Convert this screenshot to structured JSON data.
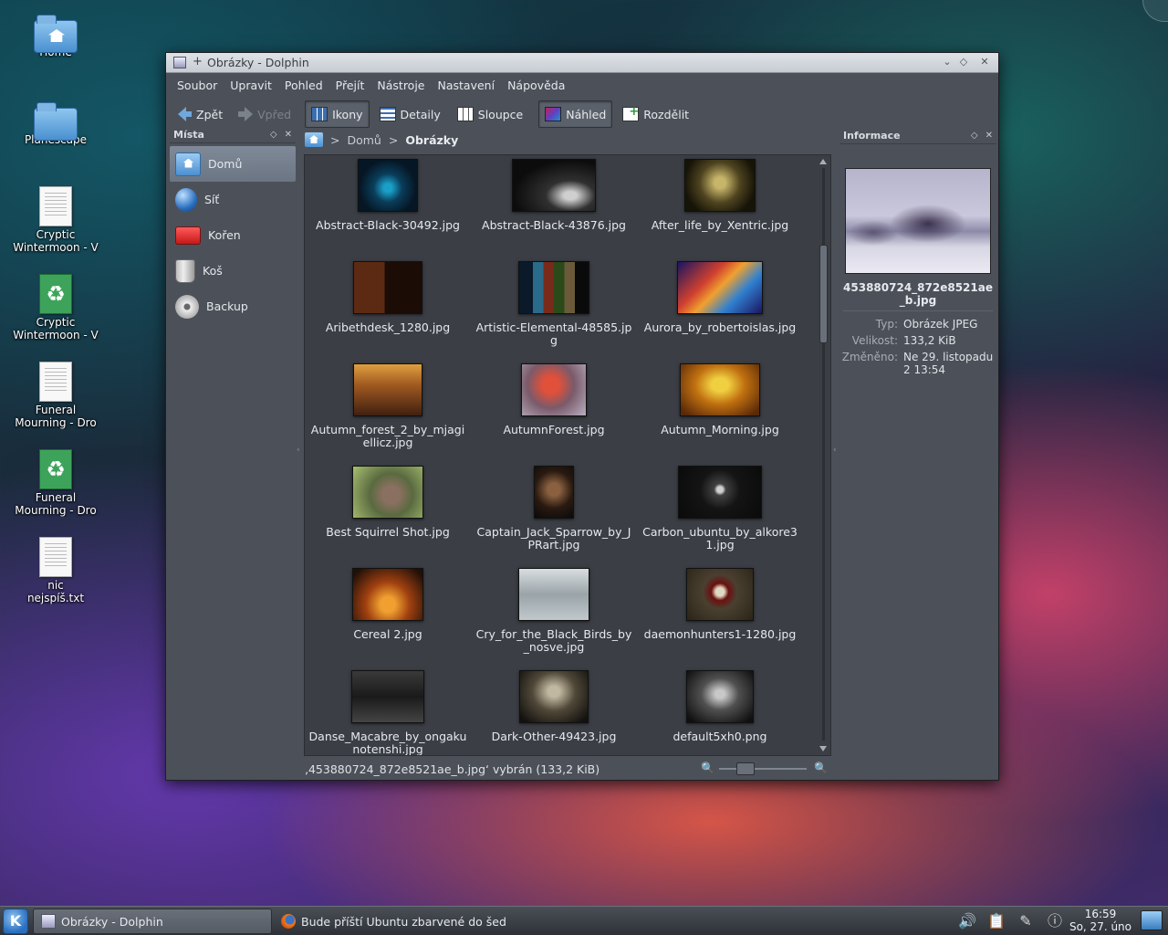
{
  "desktop": {
    "icons": [
      {
        "label": "Home",
        "kind": "home-folder"
      },
      {
        "label": "Planescape",
        "kind": "folder"
      },
      {
        "label": "Cryptic Wintermoon - V",
        "kind": "document"
      },
      {
        "label": "Cryptic Wintermoon - V",
        "kind": "recycle"
      },
      {
        "label": "Funeral Mourning - Dro",
        "kind": "document"
      },
      {
        "label": "Funeral Mourning - Dro",
        "kind": "recycle"
      },
      {
        "label": "nic nejspíš.txt",
        "kind": "document"
      }
    ]
  },
  "window": {
    "title": "Obrázky - Dolphin",
    "pin_glyph": "+",
    "buttons": {
      "minimize": "⌄",
      "maximize": "◇",
      "close": "✕"
    },
    "menu": [
      "Soubor",
      "Upravit",
      "Pohled",
      "Přejít",
      "Nástroje",
      "Nastavení",
      "Nápověda"
    ],
    "toolbar": {
      "back": "Zpět",
      "forward": "Vpřed",
      "icons": "Ikony",
      "details": "Detaily",
      "columns": "Sloupce",
      "preview": "Náhled",
      "split": "Rozdělit"
    }
  },
  "places": {
    "title": "Místa",
    "items": [
      {
        "label": "Domů",
        "icon": "home-icon",
        "selected": true
      },
      {
        "label": "Síť",
        "icon": "network-icon"
      },
      {
        "label": "Kořen",
        "icon": "root-folder-icon"
      },
      {
        "label": "Koš",
        "icon": "trash-icon"
      },
      {
        "label": "Backup",
        "icon": "backup-drive-icon"
      }
    ]
  },
  "breadcrumb": {
    "sep": ">",
    "parts": [
      "Domů",
      "Obrázky"
    ]
  },
  "files": [
    {
      "name": "Abstract-Black-30492.jpg",
      "w": 66,
      "h": 58,
      "bg": "radial-gradient(circle at 50% 55%, #1aa0c8 0 10%, #0a3d5a 35%, #061624 70%)"
    },
    {
      "name": "Abstract-Black-43876.jpg",
      "w": 92,
      "h": 58,
      "bg": "radial-gradient(ellipse at 70% 70%, #cfcfcf 0 8%, #303030 30%, #0c0c0c 70%)"
    },
    {
      "name": "After_life_by_Xentric.jpg",
      "w": 78,
      "h": 58,
      "bg": "radial-gradient(circle at 50% 45%, #c7b56a 0 12%, #4f4420 45%, #161307 80%)"
    },
    {
      "name": "Aribethdesk_1280.jpg",
      "w": 76,
      "h": 58,
      "bg": "linear-gradient(90deg, #5c2a12 0 45%, #1b0c06 45%)"
    },
    {
      "name": "Artistic-Elemental-48585.jpg",
      "w": 78,
      "h": 58,
      "bg": "linear-gradient(90deg, #0a1a2a 0 20%, #2a6a8a 20% 35%, #7a2a1a 35% 50%, #2a4a1a 50% 65%, #6a5a3a 65% 80%, #0a0a0a 80%)"
    },
    {
      "name": "Aurora_by_robertoislas.jpg",
      "w": 94,
      "h": 58,
      "bg": "linear-gradient(135deg, #1a1560 0%, #d04030 35%, #f0a030 50%, #3080d0 70%, #1a1560 100%)"
    },
    {
      "name": "Autumn_forest_2_by_mjagiellicz.jpg",
      "w": 76,
      "h": 58,
      "bg": "linear-gradient(#e0a040 0%, #a05a20 40%, #402010 100%)"
    },
    {
      "name": "AutumnForest.jpg",
      "w": 72,
      "h": 58,
      "bg": "radial-gradient(circle at 45% 40%, #e0503a 0 18%, #7a5a6a 50%, #b8b0c0 100%)"
    },
    {
      "name": "Autumn_Morning.jpg",
      "w": 88,
      "h": 58,
      "bg": "radial-gradient(ellipse at 50% 40%, #f0d040 0 15%, #c07010 45%, #5a2a08 90%)"
    },
    {
      "name": "Best Squirrel Shot.jpg",
      "w": 78,
      "h": 58,
      "bg": "radial-gradient(circle at 55% 55%, #8a7060 0 18%, #5a6a40 45%, #a8c070 100%)"
    },
    {
      "name": "Captain_Jack_Sparrow_by_JPRart.jpg",
      "w": 44,
      "h": 58,
      "bg": "radial-gradient(circle at 50% 45%, #8a6040 0 18%, #2a1a10 55%, #0a0a0a 100%)"
    },
    {
      "name": "Carbon_ubuntu_by_alkore31.jpg",
      "w": 92,
      "h": 58,
      "bg": "radial-gradient(circle at 50% 45%, #d0d0d0 0 6%, #404040 12%, #141414 40%, #0a0a0a 100%)"
    },
    {
      "name": "Cereal 2.jpg",
      "w": 78,
      "h": 58,
      "bg": "radial-gradient(ellipse at 50% 70%, #f0a030 0 15%, #a04010 45%, #201008 90%)"
    },
    {
      "name": "Cry_for_the_Black_Birds_by_nosve.jpg",
      "w": 78,
      "h": 58,
      "bg": "linear-gradient(#d8dde0 0%, #9aa4a8 50%, #c0c8cc 100%)"
    },
    {
      "name": "daemonhunters1-1280.jpg",
      "w": 74,
      "h": 58,
      "bg": "radial-gradient(circle at 50% 45%, #e0d8c0 0 10%, #6a1010 20%, #4a4030 40%, #2a2418 100%)"
    },
    {
      "name": "Danse_Macabre_by_ongakunotenshi.jpg",
      "w": 80,
      "h": 58,
      "bg": "linear-gradient(#3a3a3a 0%, #1a1a1a 50%, #444 100%)"
    },
    {
      "name": "Dark-Other-49423.jpg",
      "w": 76,
      "h": 58,
      "bg": "radial-gradient(ellipse at 50% 40%, #c0b8a0 0 12%, #504838 45%, #141210 90%)"
    },
    {
      "name": "default5xh0.png",
      "w": 74,
      "h": 58,
      "bg": "radial-gradient(ellipse at 50% 45%, #c8c8c8 0 10%, #505050 40%, #101010 90%)"
    }
  ],
  "status": {
    "text": "‚453880724_872e8521ae_b.jpg‘ vybrán (133,2 KiB)",
    "zoom_level": 0.25
  },
  "info": {
    "title": "Informace",
    "filename": "453880724_872e8521ae_b.jpg",
    "rows": [
      {
        "k": "Typ:",
        "v": "Obrázek JPEG"
      },
      {
        "k": "Velikost:",
        "v": "133,2 KiB"
      },
      {
        "k": "Změněno:",
        "v": "Ne 29. listopadu 2 13:54"
      }
    ]
  },
  "taskbar": {
    "k_label": "K",
    "tasks": [
      {
        "label": "Obrázky - Dolphin",
        "icon": "dolphin-icon",
        "active": true
      },
      {
        "label": "Bude příští Ubuntu zbarvené do šed",
        "icon": "firefox-icon",
        "active": false
      }
    ],
    "tray": [
      "volume-icon",
      "clipboard-icon",
      "network-tool-icon",
      "info-icon"
    ],
    "tray_glyphs": [
      "🔊",
      "📋",
      "✎",
      "ⓘ"
    ],
    "clock_time": "16:59",
    "clock_date": "So, 27. úno"
  }
}
